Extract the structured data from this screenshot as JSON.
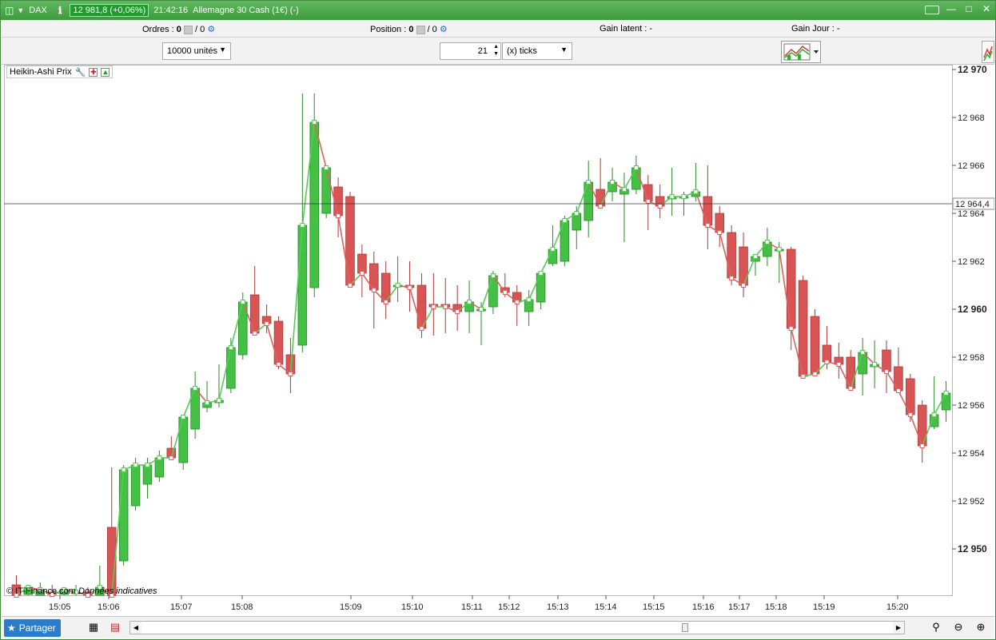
{
  "titlebar": {
    "instrument": "DAX",
    "info_icon": "info-icon",
    "price_badge": "12 981,8 (+0,06%)",
    "time": "21:42:16",
    "description": "Allemagne 30 Cash (1€) (-)",
    "colors": {
      "bar": "#4aa84a",
      "badge": "#1f9a2d"
    }
  },
  "infobar": {
    "orders_label": "Ordres :",
    "orders_value": "0",
    "orders_sep": "/ 0",
    "position_label": "Position :",
    "position_value": "0",
    "position_sep": "/ 0",
    "gain_latent_label": "Gain latent :",
    "gain_latent_value": "-",
    "gain_jour_label": "Gain Jour :",
    "gain_jour_value": "-"
  },
  "toolbar": {
    "quantity": "10000 unités",
    "ticks_value": "21",
    "ticks_unit": "(x) ticks"
  },
  "chart": {
    "indicator_label": "Heikin-Ashi Prix",
    "copyright": "© IT-Finance.com",
    "copyright_note": "Données indicatives",
    "crosshair_label": "12 964,4",
    "y_ticks": [
      "12 970",
      "12 968",
      "12 966",
      "12 964",
      "12 962",
      "12 960",
      "12 958",
      "12 956",
      "12 954",
      "12 952",
      "12 950"
    ],
    "x_ticks": [
      "15:05",
      "15:06",
      "15:07",
      "15:08",
      "15:09",
      "15:10",
      "15:11",
      "15:12",
      "15:13",
      "15:14",
      "15:15",
      "15:16",
      "15:17",
      "15:18",
      "15:19",
      "15:20"
    ],
    "colors": {
      "up": "#44c044",
      "down": "#d95555",
      "up_line": "#55cc55",
      "down_line": "#e06060"
    }
  },
  "chart_data": {
    "type": "candlestick",
    "title": "Heikin-Ashi Prix",
    "ylim": [
      12948.0,
      12970.0
    ],
    "candles": [
      {
        "o": 12948.5,
        "h": 12948.9,
        "l": 12947.8,
        "c": 12948.0
      },
      {
        "o": 12948.1,
        "h": 12948.4,
        "l": 12947.5,
        "c": 12948.4
      },
      {
        "o": 12948.0,
        "h": 12948.6,
        "l": 12947.7,
        "c": 12948.3
      },
      {
        "o": 12948.2,
        "h": 12948.5,
        "l": 12947.8,
        "c": 12948.1
      },
      {
        "o": 12948.1,
        "h": 12948.4,
        "l": 12947.6,
        "c": 12948.3
      },
      {
        "o": 12948.2,
        "h": 12948.5,
        "l": 12947.8,
        "c": 12948.2
      },
      {
        "o": 12948.2,
        "h": 12948.4,
        "l": 12947.7,
        "c": 12948.0
      },
      {
        "o": 12948.0,
        "h": 12949.3,
        "l": 12947.9,
        "c": 12948.4
      },
      {
        "o": 12950.9,
        "h": 12953.4,
        "l": 12948.0,
        "c": 12948.0
      },
      {
        "o": 12949.5,
        "h": 12953.5,
        "l": 12949.3,
        "c": 12953.3
      },
      {
        "o": 12951.8,
        "h": 12953.8,
        "l": 12951.6,
        "c": 12953.5
      },
      {
        "o": 12952.7,
        "h": 12953.8,
        "l": 12952.1,
        "c": 12953.5
      },
      {
        "o": 12953.0,
        "h": 12954.1,
        "l": 12952.8,
        "c": 12953.8
      },
      {
        "o": 12954.2,
        "h": 12954.7,
        "l": 12953.9,
        "c": 12953.8
      },
      {
        "o": 12953.6,
        "h": 12954.3,
        "l": 12953.3,
        "c": 12955.5
      },
      {
        "o": 12955.0,
        "h": 12957.4,
        "l": 12954.6,
        "c": 12956.7
      },
      {
        "o": 12955.9,
        "h": 12957.0,
        "l": 12955.7,
        "c": 12956.1
      },
      {
        "o": 12956.1,
        "h": 12957.7,
        "l": 12955.9,
        "c": 12956.2
      },
      {
        "o": 12956.7,
        "h": 12958.8,
        "l": 12956.5,
        "c": 12958.4
      },
      {
        "o": 12958.1,
        "h": 12960.7,
        "l": 12957.9,
        "c": 12960.3
      },
      {
        "o": 12960.6,
        "h": 12961.8,
        "l": 12959.2,
        "c": 12959.0
      },
      {
        "o": 12959.7,
        "h": 12960.2,
        "l": 12959.0,
        "c": 12959.4
      },
      {
        "o": 12959.5,
        "h": 12959.7,
        "l": 12957.5,
        "c": 12957.7
      },
      {
        "o": 12958.1,
        "h": 12958.8,
        "l": 12956.5,
        "c": 12957.3
      },
      {
        "o": 12958.5,
        "h": 12969.0,
        "l": 12958.2,
        "c": 12963.5
      },
      {
        "o": 12960.9,
        "h": 12969.0,
        "l": 12960.5,
        "c": 12967.8
      },
      {
        "o": 12964.0,
        "h": 12966.0,
        "l": 12963.8,
        "c": 12965.9
      },
      {
        "o": 12965.1,
        "h": 12965.5,
        "l": 12963.0,
        "c": 12963.9
      },
      {
        "o": 12964.7,
        "h": 12964.9,
        "l": 12961.3,
        "c": 12961.0
      },
      {
        "o": 12962.3,
        "h": 12962.7,
        "l": 12960.5,
        "c": 12961.5
      },
      {
        "o": 12961.9,
        "h": 12962.4,
        "l": 12959.2,
        "c": 12960.8
      },
      {
        "o": 12961.5,
        "h": 12962.0,
        "l": 12959.6,
        "c": 12960.3
      },
      {
        "o": 12961.0,
        "h": 12962.2,
        "l": 12960.3,
        "c": 12961.0
      },
      {
        "o": 12961.0,
        "h": 12962.0,
        "l": 12959.9,
        "c": 12960.9
      },
      {
        "o": 12961.0,
        "h": 12961.5,
        "l": 12958.8,
        "c": 12959.2
      },
      {
        "o": 12960.2,
        "h": 12961.5,
        "l": 12958.9,
        "c": 12960.1
      },
      {
        "o": 12960.2,
        "h": 12961.3,
        "l": 12959.0,
        "c": 12960.1
      },
      {
        "o": 12960.2,
        "h": 12961.0,
        "l": 12959.1,
        "c": 12959.9
      },
      {
        "o": 12959.9,
        "h": 12961.2,
        "l": 12959.0,
        "c": 12960.3
      },
      {
        "o": 12960.0,
        "h": 12960.3,
        "l": 12958.5,
        "c": 12960.0
      },
      {
        "o": 12960.1,
        "h": 12961.6,
        "l": 12959.8,
        "c": 12961.4
      },
      {
        "o": 12960.9,
        "h": 12961.5,
        "l": 12960.5,
        "c": 12960.7
      },
      {
        "o": 12960.7,
        "h": 12961.0,
        "l": 12959.3,
        "c": 12960.3
      },
      {
        "o": 12959.9,
        "h": 12960.8,
        "l": 12959.3,
        "c": 12960.4
      },
      {
        "o": 12960.3,
        "h": 12961.6,
        "l": 12960.0,
        "c": 12961.5
      },
      {
        "o": 12961.9,
        "h": 12963.5,
        "l": 12961.8,
        "c": 12962.5
      },
      {
        "o": 12962.0,
        "h": 12963.9,
        "l": 12961.8,
        "c": 12963.7
      },
      {
        "o": 12963.3,
        "h": 12964.3,
        "l": 12962.5,
        "c": 12964.0
      },
      {
        "o": 12963.7,
        "h": 12966.2,
        "l": 12963.0,
        "c": 12965.3
      },
      {
        "o": 12965.0,
        "h": 12966.3,
        "l": 12964.3,
        "c": 12964.3
      },
      {
        "o": 12964.9,
        "h": 12965.9,
        "l": 12964.5,
        "c": 12965.3
      },
      {
        "o": 12964.8,
        "h": 12965.7,
        "l": 12962.8,
        "c": 12965.0
      },
      {
        "o": 12965.0,
        "h": 12966.4,
        "l": 12964.8,
        "c": 12965.9
      },
      {
        "o": 12965.2,
        "h": 12965.6,
        "l": 12963.3,
        "c": 12964.5
      },
      {
        "o": 12964.7,
        "h": 12965.2,
        "l": 12963.8,
        "c": 12964.3
      },
      {
        "o": 12964.6,
        "h": 12965.9,
        "l": 12963.9,
        "c": 12964.7
      },
      {
        "o": 12964.7,
        "h": 12964.9,
        "l": 12963.9,
        "c": 12964.7
      },
      {
        "o": 12964.7,
        "h": 12966.1,
        "l": 12964.5,
        "c": 12964.9
      },
      {
        "o": 12964.7,
        "h": 12966.0,
        "l": 12962.5,
        "c": 12963.5
      },
      {
        "o": 12964.0,
        "h": 12964.3,
        "l": 12962.6,
        "c": 12963.2
      },
      {
        "o": 12963.2,
        "h": 12963.5,
        "l": 12961.0,
        "c": 12961.3
      },
      {
        "o": 12962.6,
        "h": 12963.2,
        "l": 12960.5,
        "c": 12961.0
      },
      {
        "o": 12962.0,
        "h": 12962.3,
        "l": 12961.4,
        "c": 12962.2
      },
      {
        "o": 12962.2,
        "h": 12963.4,
        "l": 12961.8,
        "c": 12962.8
      },
      {
        "o": 12962.5,
        "h": 12962.8,
        "l": 12961.1,
        "c": 12962.5
      },
      {
        "o": 12962.5,
        "h": 12962.6,
        "l": 12958.3,
        "c": 12959.2
      },
      {
        "o": 12961.2,
        "h": 12961.4,
        "l": 12957.2,
        "c": 12957.2
      },
      {
        "o": 12959.7,
        "h": 12960.0,
        "l": 12957.3,
        "c": 12957.3
      },
      {
        "o": 12958.5,
        "h": 12959.3,
        "l": 12957.5,
        "c": 12957.8
      },
      {
        "o": 12958.0,
        "h": 12958.6,
        "l": 12957.1,
        "c": 12957.7
      },
      {
        "o": 12958.0,
        "h": 12958.3,
        "l": 12956.9,
        "c": 12956.7
      },
      {
        "o": 12957.3,
        "h": 12958.8,
        "l": 12956.4,
        "c": 12958.2
      },
      {
        "o": 12957.6,
        "h": 12958.7,
        "l": 12956.7,
        "c": 12957.7
      },
      {
        "o": 12958.3,
        "h": 12958.7,
        "l": 12956.5,
        "c": 12957.4
      },
      {
        "o": 12957.6,
        "h": 12958.4,
        "l": 12956.8,
        "c": 12956.6
      },
      {
        "o": 12957.1,
        "h": 12957.3,
        "l": 12955.3,
        "c": 12955.6
      },
      {
        "o": 12956.0,
        "h": 12956.2,
        "l": 12953.6,
        "c": 12954.3
      },
      {
        "o": 12955.1,
        "h": 12957.2,
        "l": 12955.0,
        "c": 12955.6
      },
      {
        "o": 12955.8,
        "h": 12957.0,
        "l": 12955.3,
        "c": 12956.5
      }
    ]
  },
  "bottombar": {
    "share_label": "Partager",
    "icons": [
      "share-icon",
      "table-icon",
      "layout-icon",
      "zoom-reset-icon",
      "zoom-out-icon",
      "zoom-in-icon"
    ]
  }
}
